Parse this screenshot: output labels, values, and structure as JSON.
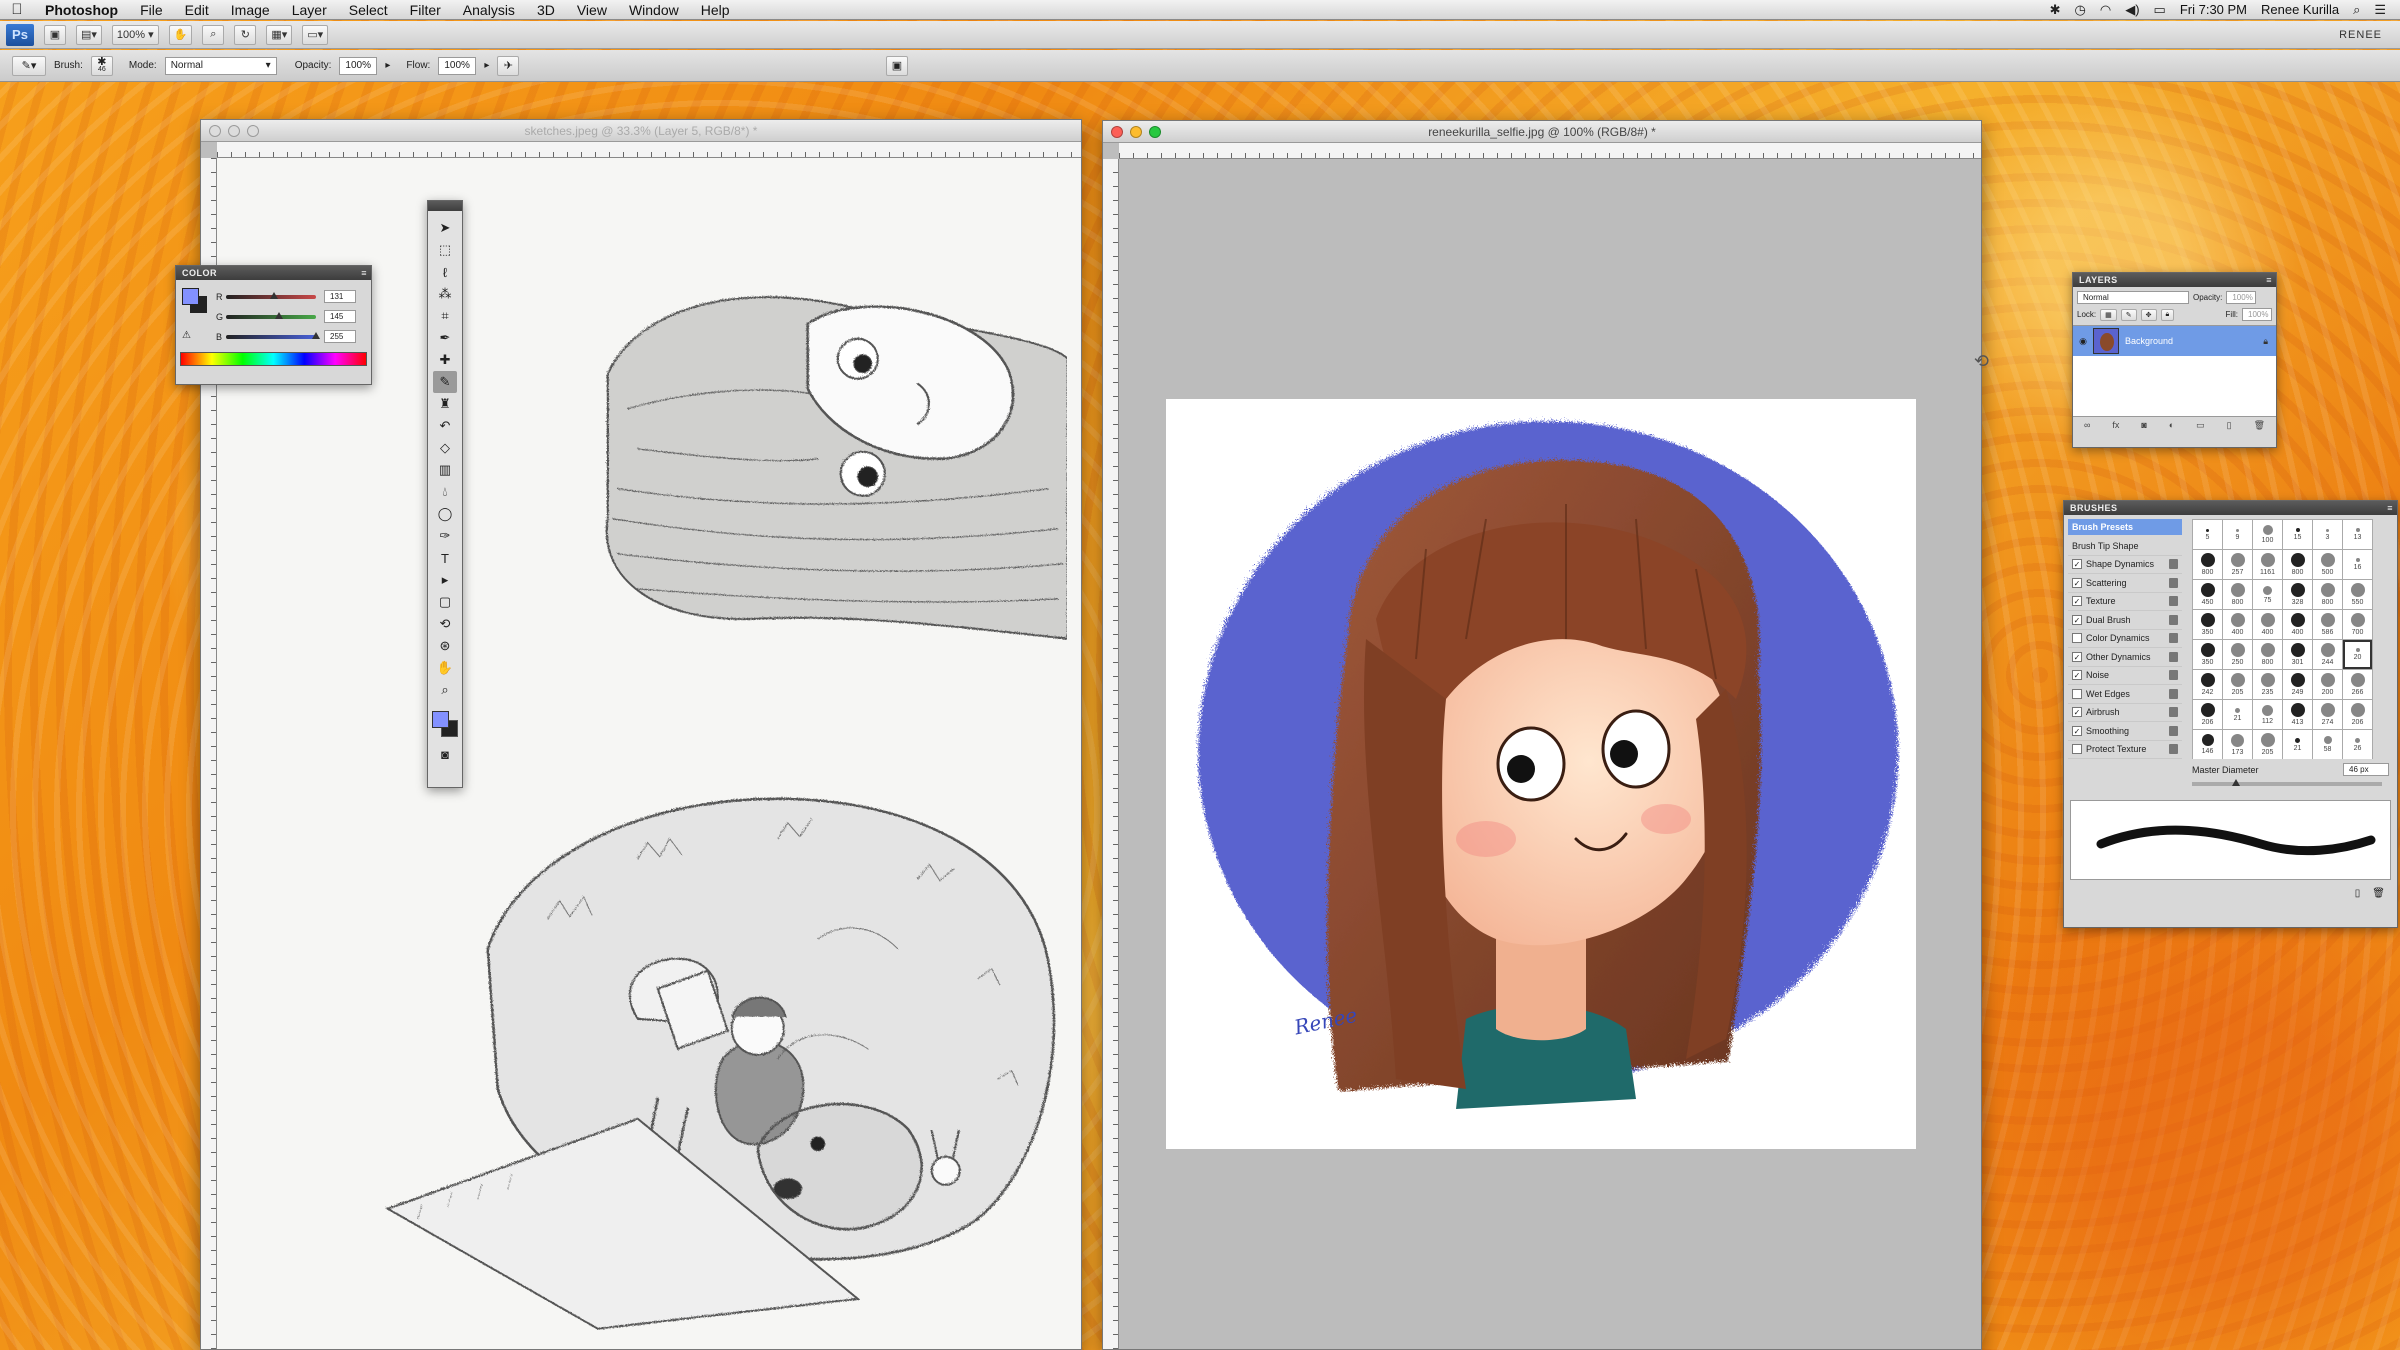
{
  "menubar": {
    "apple_label": "",
    "app_name": "Photoshop",
    "menus": [
      "File",
      "Edit",
      "Image",
      "Layer",
      "Select",
      "Filter",
      "Analysis",
      "3D",
      "View",
      "Window",
      "Help"
    ],
    "clock": "Fri 7:30 PM",
    "user": "Renee Kurilla"
  },
  "appbar": {
    "ps_label": "Ps",
    "zoom": "100%",
    "workspace": "RENEE"
  },
  "options": {
    "brush_label": "Brush:",
    "brush_size": "46",
    "mode_label": "Mode:",
    "mode_value": "Normal",
    "opacity_label": "Opacity:",
    "opacity_value": "100%",
    "flow_label": "Flow:",
    "flow_value": "100%"
  },
  "left_window": {
    "title": "sketches.jpeg @ 33.3% (Layer 5, RGB/8*) *"
  },
  "right_window": {
    "title": "reneekurilla_selfie.jpg @ 100% (RGB/8#) *",
    "signature": "Renee"
  },
  "color_panel": {
    "title": "COLOR",
    "channels": [
      {
        "label": "R",
        "value": "131",
        "fraction": 0.51,
        "color": "#c84848"
      },
      {
        "label": "G",
        "value": "145",
        "fraction": 0.57,
        "color": "#48a848"
      },
      {
        "label": "B",
        "value": "255",
        "fraction": 1.0,
        "color": "#4860d8"
      }
    ],
    "foreground_color": "#8391ff",
    "background_color": "#222222"
  },
  "layers_panel": {
    "title": "LAYERS",
    "blend_mode": "Normal",
    "opacity_label": "Opacity:",
    "opacity_value": "100%",
    "lock_label": "Lock:",
    "fill_label": "Fill:",
    "fill_value": "100%",
    "layers": [
      {
        "name": "Background",
        "selected": true
      }
    ]
  },
  "brushes_panel": {
    "title": "BRUSHES",
    "presets_button": "Brush Presets",
    "options": [
      {
        "label": "Brush Tip Shape",
        "checked": null
      },
      {
        "label": "Shape Dynamics",
        "checked": true
      },
      {
        "label": "Scattering",
        "checked": true
      },
      {
        "label": "Texture",
        "checked": true
      },
      {
        "label": "Dual Brush",
        "checked": true
      },
      {
        "label": "Color Dynamics",
        "checked": false
      },
      {
        "label": "Other Dynamics",
        "checked": true
      },
      {
        "label": "Noise",
        "checked": true
      },
      {
        "label": "Wet Edges",
        "checked": false
      },
      {
        "label": "Airbrush",
        "checked": true
      },
      {
        "label": "Smoothing",
        "checked": true
      },
      {
        "label": "Protect Texture",
        "checked": false
      }
    ],
    "tips": [
      "5",
      "9",
      "100",
      "15",
      "3",
      "13",
      "800",
      "257",
      "1161",
      "800",
      "500",
      "16",
      "450",
      "800",
      "75",
      "328",
      "800",
      "550",
      "350",
      "400",
      "400",
      "400",
      "586",
      "700",
      "350",
      "250",
      "800",
      "301",
      "244",
      "20",
      "242",
      "205",
      "235",
      "249",
      "200",
      "266",
      "206",
      "21",
      "112",
      "413",
      "274",
      "206",
      "146",
      "173",
      "205",
      "21",
      "58",
      "26"
    ],
    "master_diameter_label": "Master Diameter",
    "master_diameter_value": "46 px"
  },
  "tools": [
    "move-tool",
    "marquee-tool",
    "lasso-tool",
    "magic-wand-tool",
    "crop-tool",
    "eyedropper-tool",
    "healing-tool",
    "brush-tool",
    "stamp-tool",
    "history-brush-tool",
    "eraser-tool",
    "gradient-tool",
    "blur-tool",
    "dodge-tool",
    "pen-tool",
    "type-tool",
    "path-select-tool",
    "shape-tool",
    "3d-rotate-tool",
    "3d-orbit-tool",
    "hand-tool",
    "zoom-tool"
  ],
  "colors": {
    "selection_blue": "#6f9be6",
    "portrait_background": "#5a63cf",
    "hair": "#8a4a2a"
  }
}
